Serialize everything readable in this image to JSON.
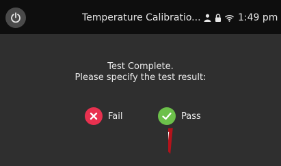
{
  "statusbar": {
    "title": "Temperature Calibratio...",
    "time": "1:49 pm",
    "icons": [
      "person-icon",
      "lock-icon",
      "wifi-icon"
    ]
  },
  "power": {
    "icon": "power-icon"
  },
  "message": {
    "line1": "Test Complete.",
    "line2": "Please specify the test result:"
  },
  "choices": {
    "fail": {
      "label": "Fail",
      "icon": "x-circle-icon",
      "color": "#e8314f"
    },
    "pass": {
      "label": "Pass",
      "icon": "check-circle-icon",
      "color": "#6cc04a"
    }
  },
  "annotation": {
    "icon": "arrow-pointer-icon",
    "color": "#b3131b"
  }
}
